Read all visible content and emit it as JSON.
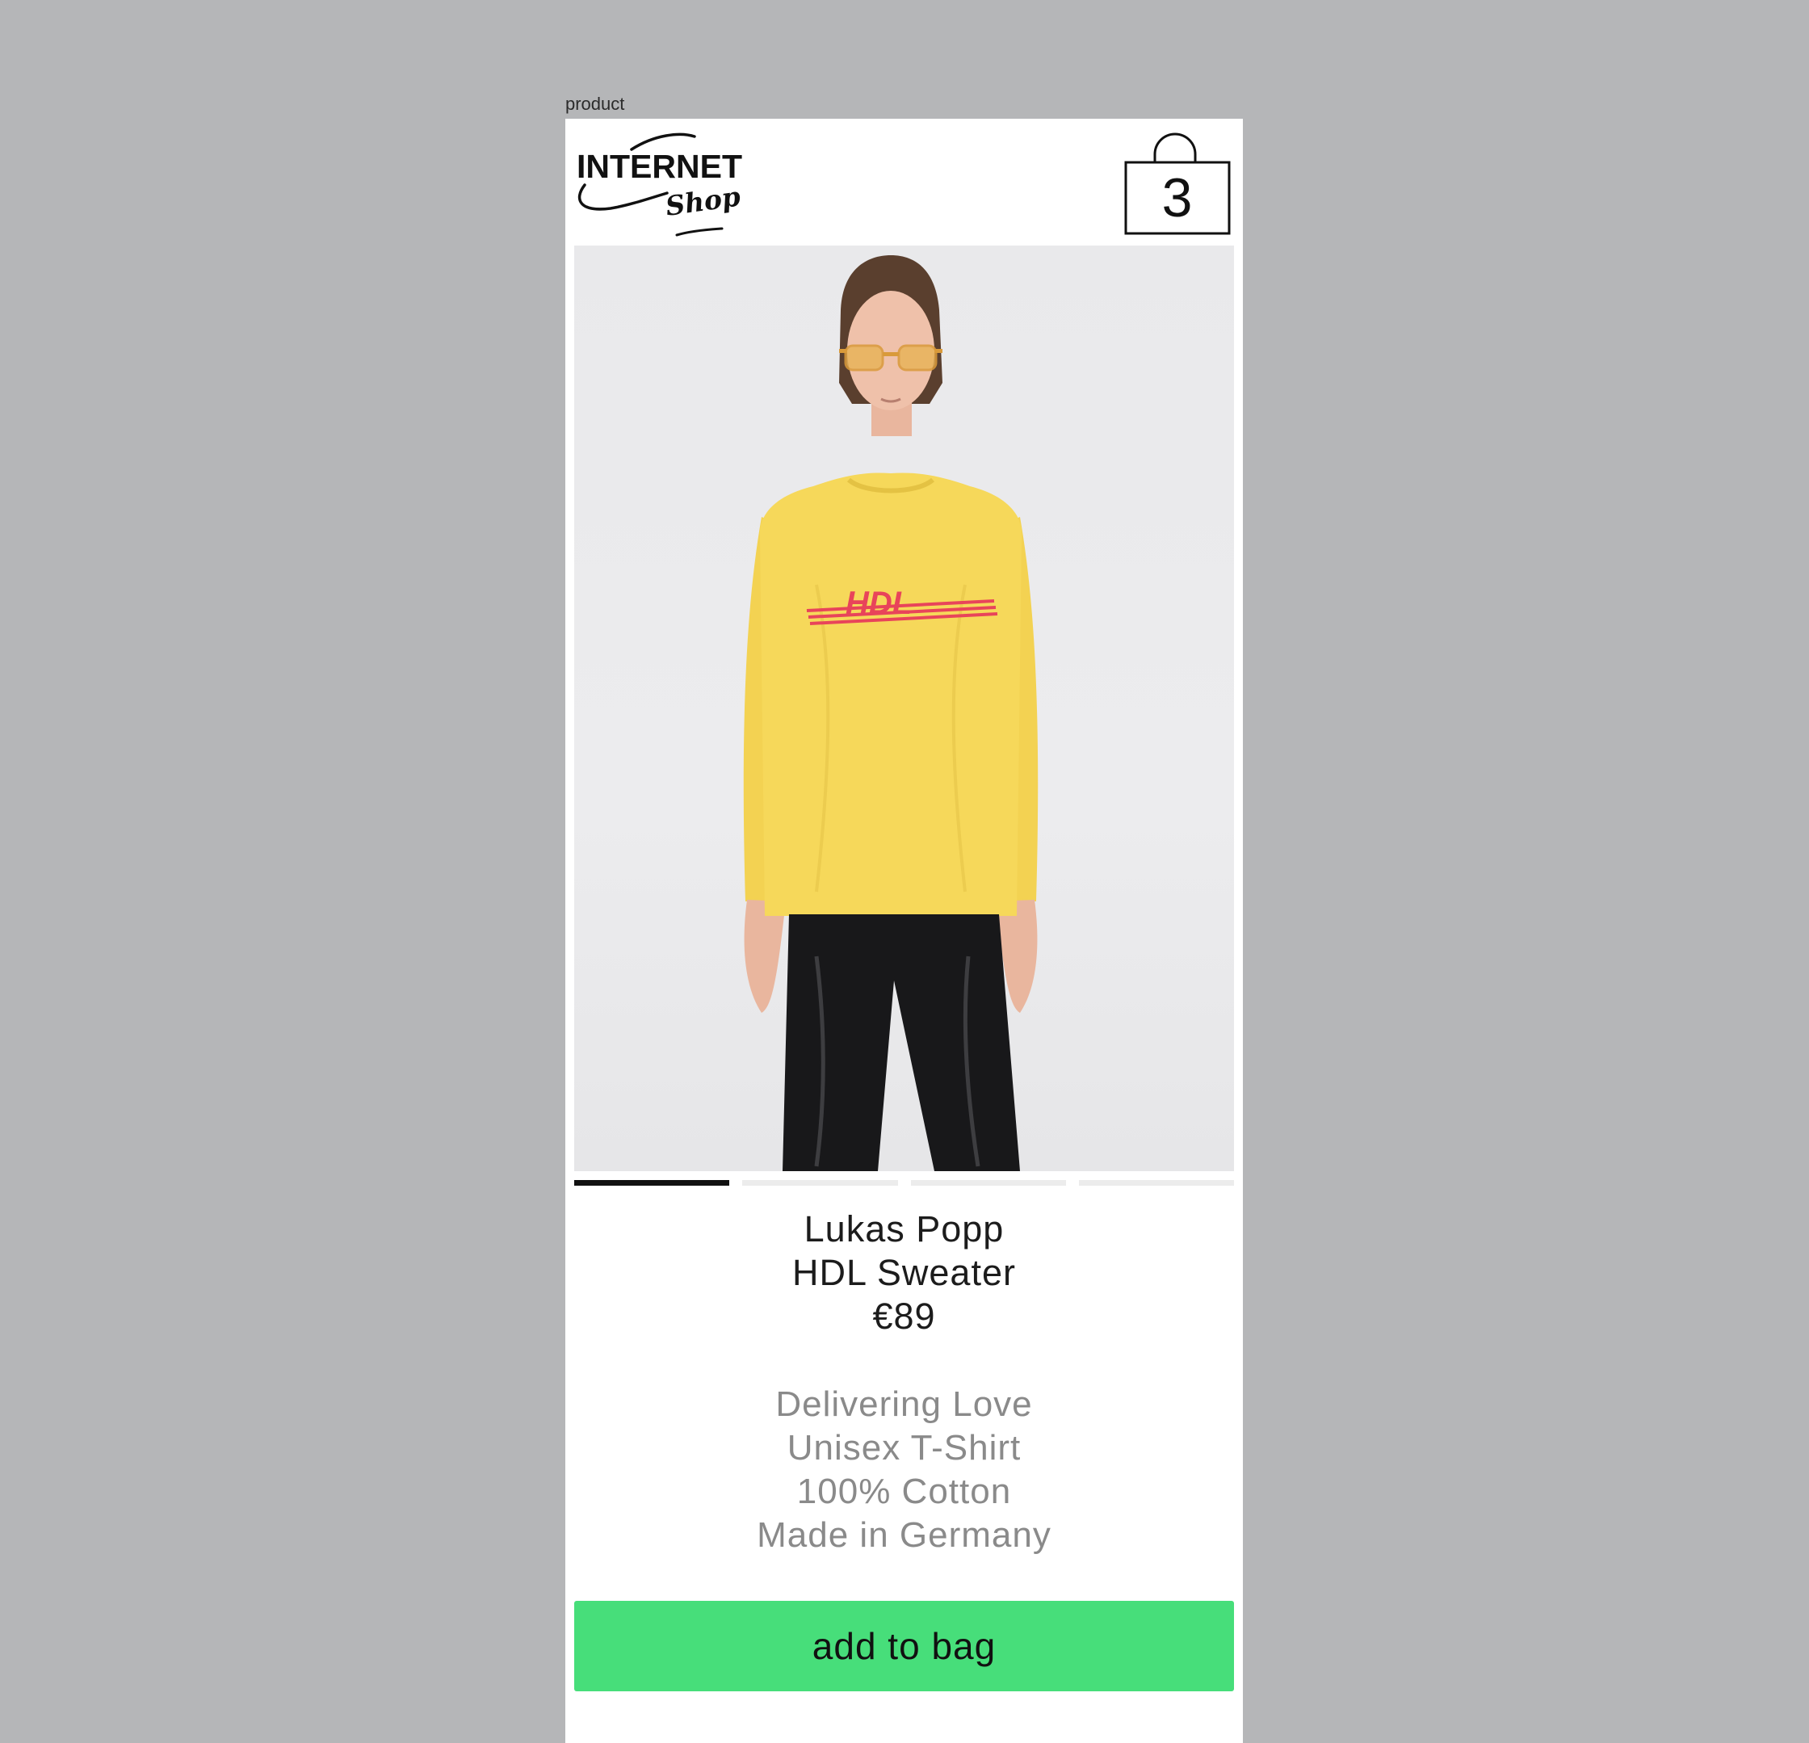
{
  "frame": {
    "label": "product"
  },
  "header": {
    "logo": {
      "line1": "INTERNET",
      "line2": "Shop"
    },
    "bag": {
      "count": "3"
    }
  },
  "product": {
    "brand": "Lukas Popp",
    "name": "HDL Sweater",
    "price": "€89",
    "print_text": "HDL",
    "description": [
      "Delivering Love",
      "Unisex T-Shirt",
      "100% Cotton",
      "Made in Germany"
    ],
    "gallery": {
      "count": 4,
      "active_index": 0
    }
  },
  "actions": {
    "add_to_bag": "add to bag"
  },
  "colors": {
    "canvas": "#b5b6b8",
    "button_green": "#47de7a",
    "sweater_yellow": "#f6d85a",
    "print_red": "#e8445a",
    "text_dark": "#1c1c1c",
    "text_muted": "#8a8a8a"
  }
}
